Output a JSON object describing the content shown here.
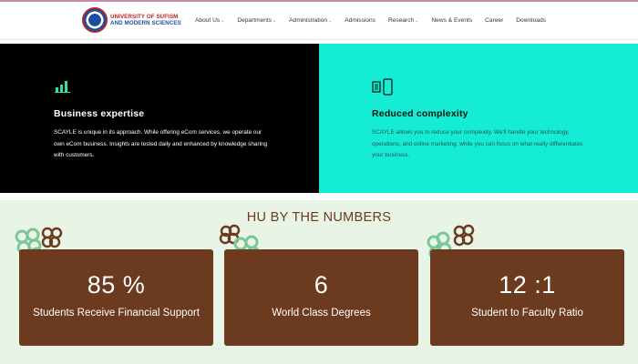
{
  "header": {
    "logo": {
      "line1": "UNIVERSITY OF SUFISM",
      "line2": "AND MODERN SCIENCES"
    },
    "menu": [
      {
        "label": "About Us",
        "has_dropdown": true
      },
      {
        "label": "Departments",
        "has_dropdown": true
      },
      {
        "label": "Administration",
        "has_dropdown": true
      },
      {
        "label": "Admissions",
        "has_dropdown": false
      },
      {
        "label": "Research",
        "has_dropdown": true
      },
      {
        "label": "News & Events",
        "has_dropdown": false
      },
      {
        "label": "Career",
        "has_dropdown": false
      },
      {
        "label": "Downloads",
        "has_dropdown": false
      }
    ],
    "dropdown_glyph": "⌄"
  },
  "features": [
    {
      "icon": "bar-chart-icon",
      "title": "Business expertise",
      "body": "SCAYLE is unique in its approach. While offering eCom services, we operate our own eCom business. Insights are tested daily and enhanced by knowledge sharing with customers.",
      "background": "#000000"
    },
    {
      "icon": "devices-icon",
      "title": "Reduced complexity",
      "body": "SCAYLE allows you to reduce your complexity. We'll handle your technology, operations, and online marketing, while you can focus on what really differentiates your business.",
      "background": "#14ecd4"
    }
  ],
  "numbers": {
    "title": "HU BY THE NUMBERS",
    "cards": [
      {
        "value": "85 %",
        "label": "Students Receive Financial Support"
      },
      {
        "value": "6",
        "label": "World Class Degrees"
      },
      {
        "value": "12 :1",
        "label": "Student to Faculty Ratio"
      }
    ],
    "colors": {
      "card": "#6b3a1f",
      "section_bg": "#e8f5e6",
      "flower_green": "#7cc79a",
      "flower_brown": "#6b3a1f"
    }
  }
}
